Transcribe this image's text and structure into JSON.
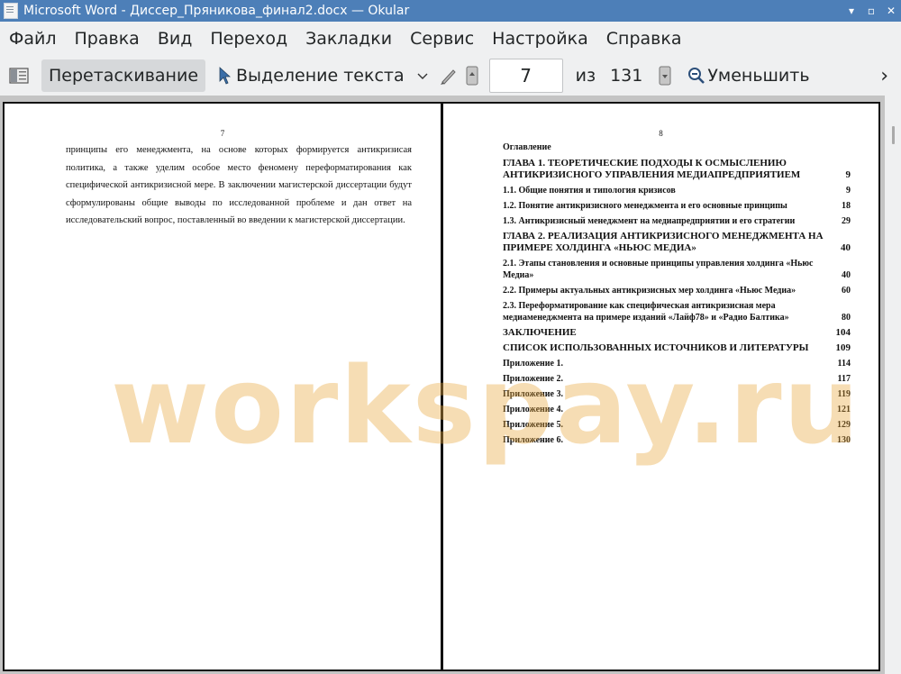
{
  "window": {
    "title": "Microsoft Word - Диссер_Пряникова_финал2.docx  — Okular",
    "min": "▾",
    "max": "▫",
    "close": "✕"
  },
  "menu": [
    "Файл",
    "Правка",
    "Вид",
    "Переход",
    "Закладки",
    "Сервис",
    "Настройка",
    "Справка"
  ],
  "toolbar": {
    "drag_label": "Перетаскивание",
    "select_label": "Выделение текста",
    "page_value": "7",
    "of_label": "из",
    "total_pages": "131",
    "zoom_out_label": "Уменьшить",
    "more": "›"
  },
  "page7": {
    "number": "7",
    "text": "принципы его менеджмента, на основе которых формируется антикризисая политика, а также уделим особое место феномену переформатирования как специфической антикризисной мере. В заключении магистерской диссертации будут сформулированы общие выводы по исследованной проблеме и дан ответ на исследовательский вопрос, поставленный во введении к магистерской диссертации."
  },
  "page8": {
    "number": "8",
    "toc_title": "Оглавление",
    "entries": [
      {
        "text": "ГЛАВА 1. ТЕОРЕТИЧЕСКИЕ ПОДХОДЫ К ОСМЫСЛЕНИЮ АНТИКРИЗИСНОГО УПРАВЛЕНИЯ МЕДИАПРЕДПРИЯТИЕМ",
        "page": "9"
      },
      {
        "text": "1.1. Общие понятия и типология кризисов",
        "page": "9"
      },
      {
        "text": "1.2. Понятие антикризисного менеджмента и его основные принципы",
        "page": "18"
      },
      {
        "text": "1.3. Антикризисный менеджмент на медиапредприятии и его стратегии",
        "page": "29"
      },
      {
        "text": "ГЛАВА 2. РЕАЛИЗАЦИЯ АНТИКРИЗИСНОГО МЕНЕДЖМЕНТА НА ПРИМЕРЕ ХОЛДИНГА «НЬЮС МЕДИА»",
        "page": "40"
      },
      {
        "text": "2.1. Этапы становления и основные принципы управления холдинга «Ньюс Медиа»",
        "page": "40"
      },
      {
        "text": "2.2. Примеры актуальных антикризисных мер холдинга «Ньюс Медиа»",
        "page": "60"
      },
      {
        "text": "2.3. Переформатирование как специфическая антикризисная мера медиаменеджмента на примере изданий «Лайф78» и «Радио Балтика»",
        "page": "80"
      },
      {
        "text": "ЗАКЛЮЧЕНИЕ",
        "page": "104"
      },
      {
        "text": "СПИСОК ИСПОЛЬЗОВАННЫХ ИСТОЧНИКОВ И ЛИТЕРАТУРЫ",
        "page": "109"
      },
      {
        "text": "Приложение 1.",
        "page": "114"
      },
      {
        "text": "Приложение 2.",
        "page": "117"
      },
      {
        "text": "Приложение 3.",
        "page": "119"
      },
      {
        "text": "Приложение 4.",
        "page": "121"
      },
      {
        "text": "Приложение 5.",
        "page": "129"
      },
      {
        "text": "Приложение 6.",
        "page": "130"
      }
    ]
  },
  "watermark": "workspay.ru"
}
